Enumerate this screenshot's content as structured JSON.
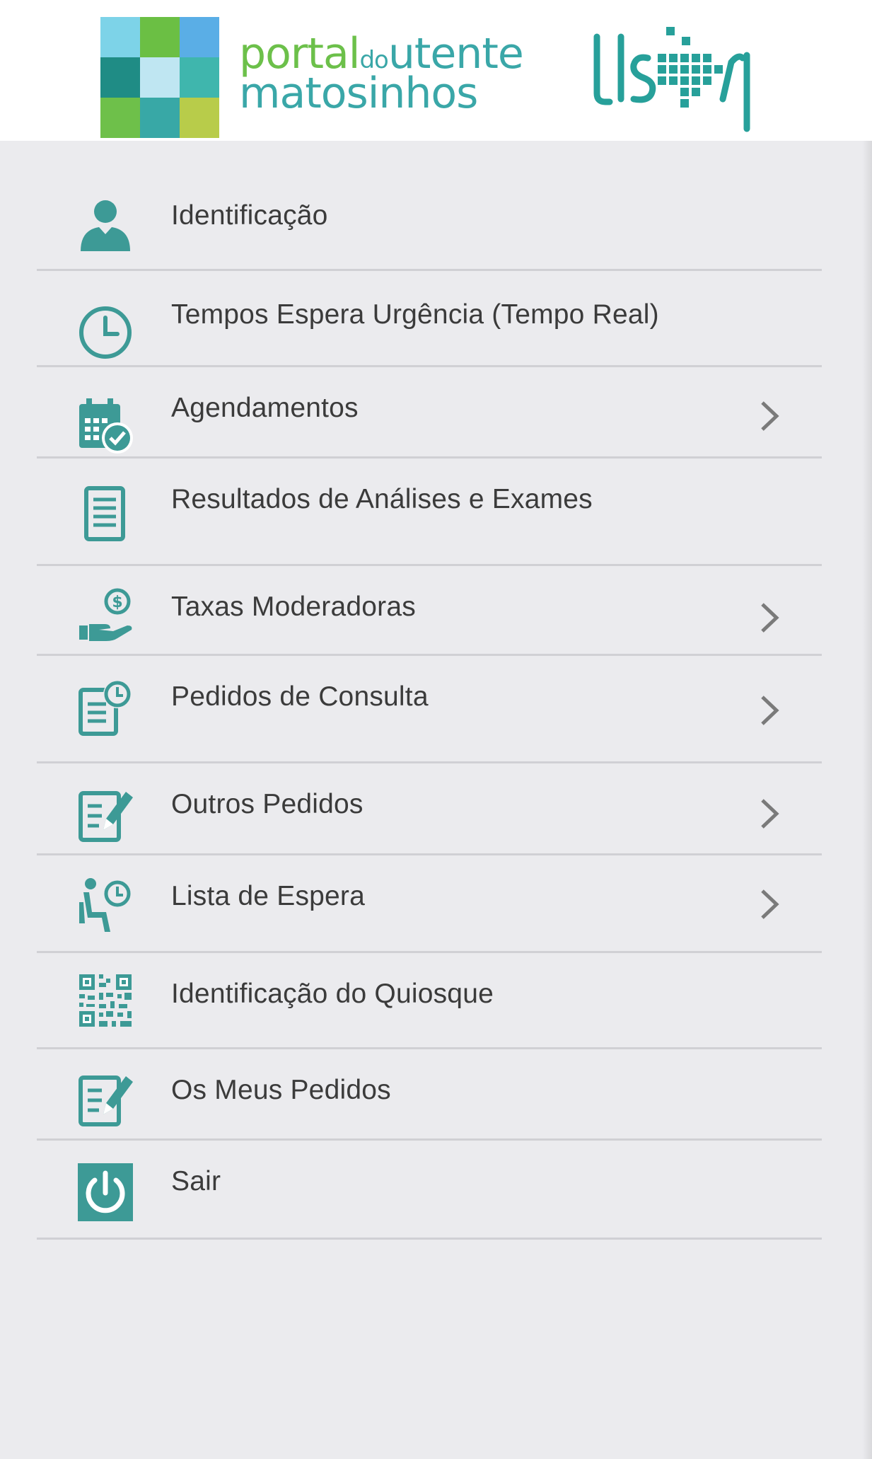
{
  "header": {
    "logo_line1_a": "portal",
    "logo_line1_b": "do",
    "logo_line1_c": "utente",
    "logo_line2": "matosinhos",
    "brand_logo": "ULSM",
    "mosaic_colors": [
      "#7dd3e8",
      "#6bbf44",
      "#5aaee6",
      "#1f8c85",
      "#bfe6f2",
      "#3fb6ad",
      "#6ec04a",
      "#38a8a6",
      "#b8cc4a"
    ]
  },
  "colors": {
    "accent": "#3d9a96",
    "text": "#3b3b3b",
    "divider": "#d0d0d4",
    "chevron": "#7a7a7a"
  },
  "menu": [
    {
      "label": "Identificação",
      "icon": "user-icon",
      "chevron": false
    },
    {
      "label": "Tempos Espera Urgência (Tempo Real)",
      "icon": "clock-icon",
      "chevron": false
    },
    {
      "label": "Agendamentos",
      "icon": "calendar-check-icon",
      "chevron": true
    },
    {
      "label": "Resultados de Análises e Exames",
      "icon": "document-icon",
      "chevron": false
    },
    {
      "label": "Taxas Moderadoras",
      "icon": "hand-money-icon",
      "chevron": true
    },
    {
      "label": "Pedidos de Consulta",
      "icon": "clipboard-clock-icon",
      "chevron": true
    },
    {
      "label": "Outros Pedidos",
      "icon": "edit-document-icon",
      "chevron": true
    },
    {
      "label": "Lista de Espera",
      "icon": "waiting-seat-icon",
      "chevron": true
    },
    {
      "label": "Identificação do Quiosque",
      "icon": "qr-code-icon",
      "chevron": false
    },
    {
      "label": "Os Meus Pedidos",
      "icon": "edit-document-icon",
      "chevron": false
    },
    {
      "label": "Sair",
      "icon": "power-icon",
      "chevron": false
    }
  ]
}
